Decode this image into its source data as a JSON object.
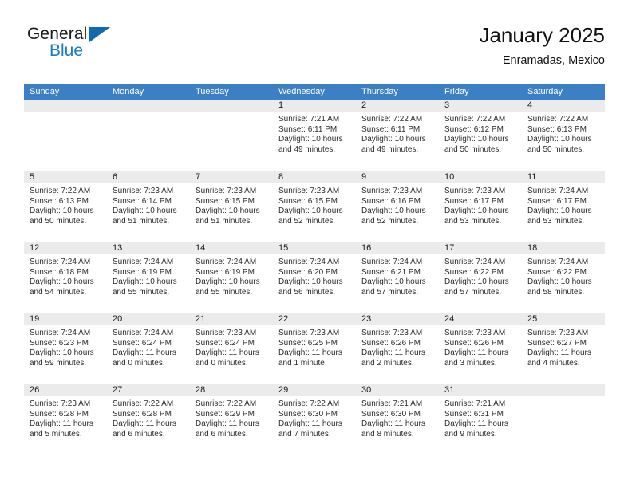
{
  "brand": {
    "name_part1": "General",
    "name_part2": "Blue",
    "triangle_color": "#1169b0",
    "blue_color": "#1a7bc4"
  },
  "header": {
    "title": "January 2025",
    "subtitle": "Enramadas, Mexico"
  },
  "theme": {
    "header_bar_color": "#3b7fc4",
    "day_number_bg": "#ebebeb",
    "text_color": "#2b2b2b"
  },
  "weekdays": [
    "Sunday",
    "Monday",
    "Tuesday",
    "Wednesday",
    "Thursday",
    "Friday",
    "Saturday"
  ],
  "weeks": [
    [
      {
        "day": "",
        "empty": true,
        "sunrise": "",
        "sunset": "",
        "daylight1": "",
        "daylight2": ""
      },
      {
        "day": "",
        "empty": true,
        "sunrise": "",
        "sunset": "",
        "daylight1": "",
        "daylight2": ""
      },
      {
        "day": "",
        "empty": true,
        "sunrise": "",
        "sunset": "",
        "daylight1": "",
        "daylight2": ""
      },
      {
        "day": "1",
        "empty": false,
        "sunrise": "Sunrise: 7:21 AM",
        "sunset": "Sunset: 6:11 PM",
        "daylight1": "Daylight: 10 hours",
        "daylight2": "and 49 minutes."
      },
      {
        "day": "2",
        "empty": false,
        "sunrise": "Sunrise: 7:22 AM",
        "sunset": "Sunset: 6:11 PM",
        "daylight1": "Daylight: 10 hours",
        "daylight2": "and 49 minutes."
      },
      {
        "day": "3",
        "empty": false,
        "sunrise": "Sunrise: 7:22 AM",
        "sunset": "Sunset: 6:12 PM",
        "daylight1": "Daylight: 10 hours",
        "daylight2": "and 50 minutes."
      },
      {
        "day": "4",
        "empty": false,
        "sunrise": "Sunrise: 7:22 AM",
        "sunset": "Sunset: 6:13 PM",
        "daylight1": "Daylight: 10 hours",
        "daylight2": "and 50 minutes."
      }
    ],
    [
      {
        "day": "5",
        "empty": false,
        "sunrise": "Sunrise: 7:22 AM",
        "sunset": "Sunset: 6:13 PM",
        "daylight1": "Daylight: 10 hours",
        "daylight2": "and 50 minutes."
      },
      {
        "day": "6",
        "empty": false,
        "sunrise": "Sunrise: 7:23 AM",
        "sunset": "Sunset: 6:14 PM",
        "daylight1": "Daylight: 10 hours",
        "daylight2": "and 51 minutes."
      },
      {
        "day": "7",
        "empty": false,
        "sunrise": "Sunrise: 7:23 AM",
        "sunset": "Sunset: 6:15 PM",
        "daylight1": "Daylight: 10 hours",
        "daylight2": "and 51 minutes."
      },
      {
        "day": "8",
        "empty": false,
        "sunrise": "Sunrise: 7:23 AM",
        "sunset": "Sunset: 6:15 PM",
        "daylight1": "Daylight: 10 hours",
        "daylight2": "and 52 minutes."
      },
      {
        "day": "9",
        "empty": false,
        "sunrise": "Sunrise: 7:23 AM",
        "sunset": "Sunset: 6:16 PM",
        "daylight1": "Daylight: 10 hours",
        "daylight2": "and 52 minutes."
      },
      {
        "day": "10",
        "empty": false,
        "sunrise": "Sunrise: 7:23 AM",
        "sunset": "Sunset: 6:17 PM",
        "daylight1": "Daylight: 10 hours",
        "daylight2": "and 53 minutes."
      },
      {
        "day": "11",
        "empty": false,
        "sunrise": "Sunrise: 7:24 AM",
        "sunset": "Sunset: 6:17 PM",
        "daylight1": "Daylight: 10 hours",
        "daylight2": "and 53 minutes."
      }
    ],
    [
      {
        "day": "12",
        "empty": false,
        "sunrise": "Sunrise: 7:24 AM",
        "sunset": "Sunset: 6:18 PM",
        "daylight1": "Daylight: 10 hours",
        "daylight2": "and 54 minutes."
      },
      {
        "day": "13",
        "empty": false,
        "sunrise": "Sunrise: 7:24 AM",
        "sunset": "Sunset: 6:19 PM",
        "daylight1": "Daylight: 10 hours",
        "daylight2": "and 55 minutes."
      },
      {
        "day": "14",
        "empty": false,
        "sunrise": "Sunrise: 7:24 AM",
        "sunset": "Sunset: 6:19 PM",
        "daylight1": "Daylight: 10 hours",
        "daylight2": "and 55 minutes."
      },
      {
        "day": "15",
        "empty": false,
        "sunrise": "Sunrise: 7:24 AM",
        "sunset": "Sunset: 6:20 PM",
        "daylight1": "Daylight: 10 hours",
        "daylight2": "and 56 minutes."
      },
      {
        "day": "16",
        "empty": false,
        "sunrise": "Sunrise: 7:24 AM",
        "sunset": "Sunset: 6:21 PM",
        "daylight1": "Daylight: 10 hours",
        "daylight2": "and 57 minutes."
      },
      {
        "day": "17",
        "empty": false,
        "sunrise": "Sunrise: 7:24 AM",
        "sunset": "Sunset: 6:22 PM",
        "daylight1": "Daylight: 10 hours",
        "daylight2": "and 57 minutes."
      },
      {
        "day": "18",
        "empty": false,
        "sunrise": "Sunrise: 7:24 AM",
        "sunset": "Sunset: 6:22 PM",
        "daylight1": "Daylight: 10 hours",
        "daylight2": "and 58 minutes."
      }
    ],
    [
      {
        "day": "19",
        "empty": false,
        "sunrise": "Sunrise: 7:24 AM",
        "sunset": "Sunset: 6:23 PM",
        "daylight1": "Daylight: 10 hours",
        "daylight2": "and 59 minutes."
      },
      {
        "day": "20",
        "empty": false,
        "sunrise": "Sunrise: 7:24 AM",
        "sunset": "Sunset: 6:24 PM",
        "daylight1": "Daylight: 11 hours",
        "daylight2": "and 0 minutes."
      },
      {
        "day": "21",
        "empty": false,
        "sunrise": "Sunrise: 7:23 AM",
        "sunset": "Sunset: 6:24 PM",
        "daylight1": "Daylight: 11 hours",
        "daylight2": "and 0 minutes."
      },
      {
        "day": "22",
        "empty": false,
        "sunrise": "Sunrise: 7:23 AM",
        "sunset": "Sunset: 6:25 PM",
        "daylight1": "Daylight: 11 hours",
        "daylight2": "and 1 minute."
      },
      {
        "day": "23",
        "empty": false,
        "sunrise": "Sunrise: 7:23 AM",
        "sunset": "Sunset: 6:26 PM",
        "daylight1": "Daylight: 11 hours",
        "daylight2": "and 2 minutes."
      },
      {
        "day": "24",
        "empty": false,
        "sunrise": "Sunrise: 7:23 AM",
        "sunset": "Sunset: 6:26 PM",
        "daylight1": "Daylight: 11 hours",
        "daylight2": "and 3 minutes."
      },
      {
        "day": "25",
        "empty": false,
        "sunrise": "Sunrise: 7:23 AM",
        "sunset": "Sunset: 6:27 PM",
        "daylight1": "Daylight: 11 hours",
        "daylight2": "and 4 minutes."
      }
    ],
    [
      {
        "day": "26",
        "empty": false,
        "sunrise": "Sunrise: 7:23 AM",
        "sunset": "Sunset: 6:28 PM",
        "daylight1": "Daylight: 11 hours",
        "daylight2": "and 5 minutes."
      },
      {
        "day": "27",
        "empty": false,
        "sunrise": "Sunrise: 7:22 AM",
        "sunset": "Sunset: 6:28 PM",
        "daylight1": "Daylight: 11 hours",
        "daylight2": "and 6 minutes."
      },
      {
        "day": "28",
        "empty": false,
        "sunrise": "Sunrise: 7:22 AM",
        "sunset": "Sunset: 6:29 PM",
        "daylight1": "Daylight: 11 hours",
        "daylight2": "and 6 minutes."
      },
      {
        "day": "29",
        "empty": false,
        "sunrise": "Sunrise: 7:22 AM",
        "sunset": "Sunset: 6:30 PM",
        "daylight1": "Daylight: 11 hours",
        "daylight2": "and 7 minutes."
      },
      {
        "day": "30",
        "empty": false,
        "sunrise": "Sunrise: 7:21 AM",
        "sunset": "Sunset: 6:30 PM",
        "daylight1": "Daylight: 11 hours",
        "daylight2": "and 8 minutes."
      },
      {
        "day": "31",
        "empty": false,
        "sunrise": "Sunrise: 7:21 AM",
        "sunset": "Sunset: 6:31 PM",
        "daylight1": "Daylight: 11 hours",
        "daylight2": "and 9 minutes."
      },
      {
        "day": "",
        "empty": true,
        "sunrise": "",
        "sunset": "",
        "daylight1": "",
        "daylight2": ""
      }
    ]
  ]
}
